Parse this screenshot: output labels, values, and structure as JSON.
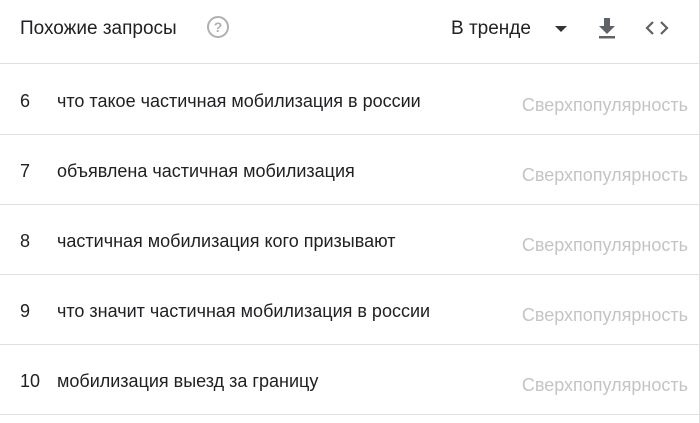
{
  "header": {
    "title": "Похожие запросы",
    "help_icon": "help-circle-icon",
    "sort_label": "В тренде",
    "download_icon": "download-icon",
    "embed_icon": "embed-code-icon"
  },
  "rows": [
    {
      "index": "6",
      "query": "что такое частичная мобилизация в россии",
      "value": "Сверхпопулярность"
    },
    {
      "index": "7",
      "query": "объявлена частичная мобилизация",
      "value": "Сверхпопулярность"
    },
    {
      "index": "8",
      "query": "частичная мобилизация кого призывают",
      "value": "Сверхпопулярность"
    },
    {
      "index": "9",
      "query": "что значит частичная мобилизация в россии",
      "value": "Сверхпопулярность"
    },
    {
      "index": "10",
      "query": "мобилизация выезд за границу",
      "value": "Сверхпопулярность"
    }
  ],
  "colors": {
    "text": "#202124",
    "muted": "#c4c4c4",
    "divider": "#e0e0e0"
  }
}
